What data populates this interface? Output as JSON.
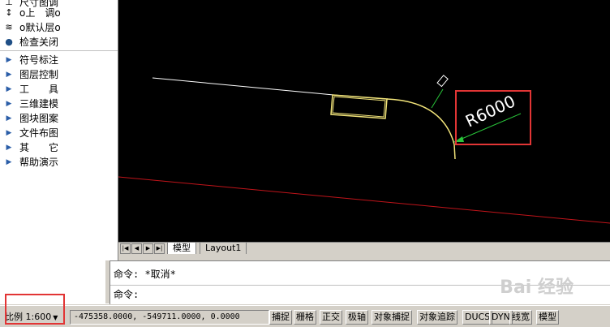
{
  "sidebar": {
    "top_items": [
      {
        "icon": "format-icon",
        "label": "尺寸图调"
      },
      {
        "icon": "up-arrow-icon",
        "label": "o上　调o"
      },
      {
        "icon": "layer-icon",
        "label": "o默认层o"
      },
      {
        "icon": "bulb-icon",
        "label": "检查关闭"
      }
    ],
    "menu_items": [
      {
        "icon": "triangle-right-icon",
        "label": "符号标注"
      },
      {
        "icon": "triangle-right-icon",
        "label": "图层控制"
      },
      {
        "icon": "triangle-right-icon",
        "label": "工　　具"
      },
      {
        "icon": "triangle-right-icon",
        "label": "三维建模"
      },
      {
        "icon": "triangle-right-icon",
        "label": "图块图案"
      },
      {
        "icon": "triangle-right-icon",
        "label": "文件布图"
      },
      {
        "icon": "triangle-right-icon",
        "label": "其　　它"
      },
      {
        "icon": "triangle-right-icon",
        "label": "帮助演示"
      }
    ]
  },
  "drawing": {
    "dimension_text": "R6000",
    "colors": {
      "background": "#000000",
      "arc": "#f3e57a",
      "leader": "#29c43a",
      "axis_line": "#c0141a",
      "polyline": "#ffffff",
      "highlight": "#e23535"
    }
  },
  "tabs": {
    "model": "模型",
    "layout1": "Layout1"
  },
  "command": {
    "line1": "命令: *取消*",
    "line2": "命令:"
  },
  "status": {
    "scale": "比例 1:600",
    "coords": "-475358.0000, -549711.0000, 0.0000",
    "buttons": [
      "捕捉",
      "栅格",
      "正交",
      "极轴",
      "对象捕捉",
      "对象追踪",
      "DUCS",
      "DYN",
      "线宽",
      "模型"
    ]
  },
  "watermark": "Bai 经验"
}
